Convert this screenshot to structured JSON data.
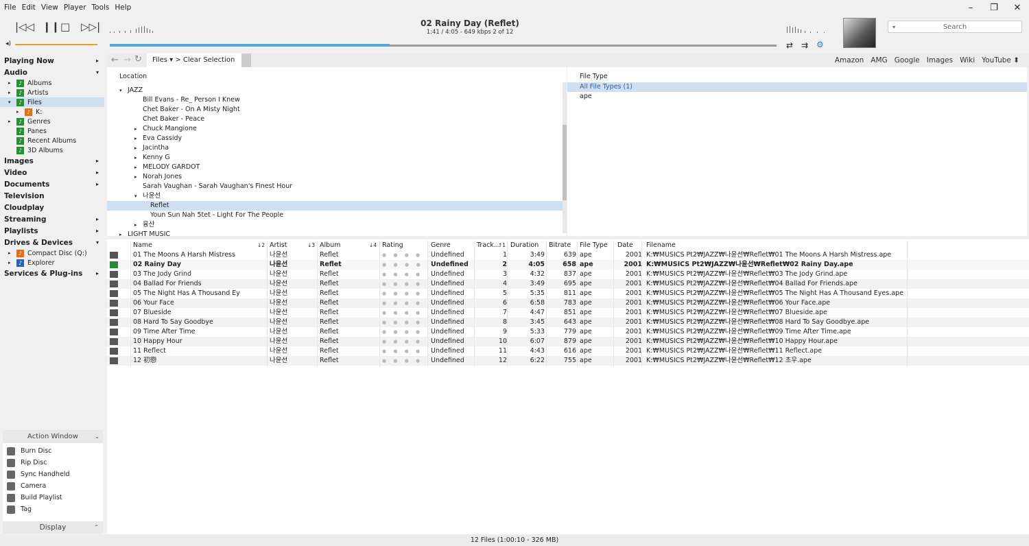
{
  "menu": [
    "File",
    "Edit",
    "View",
    "Player",
    "Tools",
    "Help"
  ],
  "window_controls": [
    "–",
    "❐",
    "✕"
  ],
  "transport": {
    "prev": "|◁◁",
    "pause": "❙❙",
    "stop": "□",
    "next": "▷▷|"
  },
  "now_playing": {
    "title": "02 Rainy Day (Reflet)",
    "info": "1:41 / 4:05 -  649 kbps   2 of 12",
    "progress": 0.42
  },
  "search": {
    "placeholder": "Search"
  },
  "sidebar": {
    "sections": [
      {
        "label": "Playing Now",
        "arrow": "▸"
      },
      {
        "label": "Audio",
        "arrow": "▾"
      }
    ],
    "audio_items": [
      "Albums",
      "Artists",
      "Files",
      "K:",
      "Genres",
      "Panes",
      "Recent Albums",
      "3D Albums"
    ],
    "sections2": [
      {
        "label": "Images",
        "arrow": "▸"
      },
      {
        "label": "Video",
        "arrow": "▸"
      },
      {
        "label": "Documents",
        "arrow": "▸"
      },
      {
        "label": "Television",
        "arrow": ""
      },
      {
        "label": "Cloudplay",
        "arrow": ""
      },
      {
        "label": "Streaming",
        "arrow": "▸"
      },
      {
        "label": "Playlists",
        "arrow": "▸"
      },
      {
        "label": "Drives & Devices",
        "arrow": "▾"
      }
    ],
    "drive_items": [
      "Compact Disc (Q:)",
      "Explorer"
    ],
    "last_section": {
      "label": "Services & Plug-ins",
      "arrow": "▸"
    }
  },
  "action_window": {
    "title": "Action Window",
    "items": [
      "Burn Disc",
      "Rip Disc",
      "Sync Handheld",
      "Camera",
      "Build Playlist",
      "Tag"
    ],
    "display_label": "Display"
  },
  "toolbar": {
    "files_tab": "Files ▾  >  Clear Selection",
    "links": [
      "Amazon",
      "AMG",
      "Google",
      "Images",
      "Wiki",
      "YouTube ⬍"
    ]
  },
  "location": {
    "header": "Location",
    "items": [
      {
        "label": "JAZZ",
        "indent": 1,
        "tri": "▾"
      },
      {
        "label": "Bill Evans - Re_ Person I Knew",
        "indent": 2,
        "tri": ""
      },
      {
        "label": "Chet Baker - On A Misty Night",
        "indent": 2,
        "tri": ""
      },
      {
        "label": "Chet Baker - Peace",
        "indent": 2,
        "tri": ""
      },
      {
        "label": "Chuck Mangione",
        "indent": 2,
        "tri": "▸"
      },
      {
        "label": "Eva Cassidy",
        "indent": 2,
        "tri": "▸"
      },
      {
        "label": "Jacintha",
        "indent": 2,
        "tri": "▸"
      },
      {
        "label": "Kenny G",
        "indent": 2,
        "tri": "▸"
      },
      {
        "label": "MELODY GARDOT",
        "indent": 2,
        "tri": "▸"
      },
      {
        "label": "Norah Jones",
        "indent": 2,
        "tri": "▸"
      },
      {
        "label": "Sarah Vaughan - Sarah Vaughan's Finest Hour",
        "indent": 2,
        "tri": ""
      },
      {
        "label": "나윤선",
        "indent": 2,
        "tri": "▾"
      },
      {
        "label": "Reflet",
        "indent": 3,
        "tri": "",
        "selected": true
      },
      {
        "label": "Youn Sun Nah 5tet - Light For The People",
        "indent": 3,
        "tri": ""
      },
      {
        "label": "융산",
        "indent": 2,
        "tri": "▸"
      },
      {
        "label": "LIGHT MUSIC",
        "indent": 1,
        "tri": "▸"
      }
    ]
  },
  "file_type": {
    "header": "File Type",
    "items": [
      "All File Types (1)",
      "ape"
    ]
  },
  "columns": [
    "Name",
    "↓2",
    "Artist",
    "↓3",
    "Album",
    "↓4",
    "Rating",
    "Genre",
    "Track...",
    "↑1",
    "Duration",
    "Bitrate",
    "File Type",
    "Date",
    "Filename"
  ],
  "tracks": [
    {
      "name": "01 The Moons A Harsh Mistress",
      "artist": "나윤선",
      "album": "Reflet",
      "rating": "● ● ● ● ●",
      "genre": "Undefined",
      "track": "1",
      "duration": "3:49",
      "bitrate": "639",
      "type": "ape",
      "date": "2001",
      "file": "K:₩MUSICS Pt2₩JAZZ₩나윤선₩Reflet₩01 The Moons A Harsh Mistress.ape"
    },
    {
      "name": "02 Rainy Day",
      "artist": "나윤선",
      "album": "Reflet",
      "rating": "● ● ● ● ●",
      "genre": "Undefined",
      "track": "2",
      "duration": "4:05",
      "bitrate": "658",
      "type": "ape",
      "date": "2001",
      "file": "K:₩MUSICS Pt2₩JAZZ₩나윤선₩Reflet₩02 Rainy Day.ape",
      "playing": true
    },
    {
      "name": "03 The Jody Grind",
      "artist": "나윤선",
      "album": "Reflet",
      "rating": "● ● ● ● ●",
      "genre": "Undefined",
      "track": "3",
      "duration": "4:32",
      "bitrate": "837",
      "type": "ape",
      "date": "2001",
      "file": "K:₩MUSICS Pt2₩JAZZ₩나윤선₩Reflet₩03 The Jody Grind.ape"
    },
    {
      "name": "04 Ballad For Friends",
      "artist": "나윤선",
      "album": "Reflet",
      "rating": "● ● ● ● ●",
      "genre": "Undefined",
      "track": "4",
      "duration": "3:49",
      "bitrate": "695",
      "type": "ape",
      "date": "2001",
      "file": "K:₩MUSICS Pt2₩JAZZ₩나윤선₩Reflet₩04 Ballad For Friends.ape"
    },
    {
      "name": "05 The Night Has A Thousand Ey",
      "artist": "나윤선",
      "album": "Reflet",
      "rating": "● ● ● ● ●",
      "genre": "Undefined",
      "track": "5",
      "duration": "5:35",
      "bitrate": "811",
      "type": "ape",
      "date": "2001",
      "file": "K:₩MUSICS Pt2₩JAZZ₩나윤선₩Reflet₩05 The Night Has A Thousand Eyes.ape"
    },
    {
      "name": "06 Your Face",
      "artist": "나윤선",
      "album": "Reflet",
      "rating": "● ● ● ● ●",
      "genre": "Undefined",
      "track": "6",
      "duration": "6:58",
      "bitrate": "783",
      "type": "ape",
      "date": "2001",
      "file": "K:₩MUSICS Pt2₩JAZZ₩나윤선₩Reflet₩06 Your Face.ape"
    },
    {
      "name": "07 Blueside",
      "artist": "나윤선",
      "album": "Reflet",
      "rating": "● ● ● ● ●",
      "genre": "Undefined",
      "track": "7",
      "duration": "4:47",
      "bitrate": "851",
      "type": "ape",
      "date": "2001",
      "file": "K:₩MUSICS Pt2₩JAZZ₩나윤선₩Reflet₩07 Blueside.ape"
    },
    {
      "name": "08 Hard To Say Goodbye",
      "artist": "나윤선",
      "album": "Reflet",
      "rating": "● ● ● ● ●",
      "genre": "Undefined",
      "track": "8",
      "duration": "3:45",
      "bitrate": "643",
      "type": "ape",
      "date": "2001",
      "file": "K:₩MUSICS Pt2₩JAZZ₩나윤선₩Reflet₩08 Hard To Say Goodbye.ape"
    },
    {
      "name": "09 Time After Time",
      "artist": "나윤선",
      "album": "Reflet",
      "rating": "● ● ● ● ●",
      "genre": "Undefined",
      "track": "9",
      "duration": "5:33",
      "bitrate": "779",
      "type": "ape",
      "date": "2001",
      "file": "K:₩MUSICS Pt2₩JAZZ₩나윤선₩Reflet₩09 Time After Time.ape"
    },
    {
      "name": "10 Happy Hour",
      "artist": "나윤선",
      "album": "Reflet",
      "rating": "● ● ● ● ●",
      "genre": "Undefined",
      "track": "10",
      "duration": "6:07",
      "bitrate": "879",
      "type": "ape",
      "date": "2001",
      "file": "K:₩MUSICS Pt2₩JAZZ₩나윤선₩Reflet₩10 Happy Hour.ape"
    },
    {
      "name": "11 Reflect",
      "artist": "나윤선",
      "album": "Reflet",
      "rating": "● ● ● ● ●",
      "genre": "Undefined",
      "track": "11",
      "duration": "4:43",
      "bitrate": "616",
      "type": "ape",
      "date": "2001",
      "file": "K:₩MUSICS Pt2₩JAZZ₩나윤선₩Reflet₩11 Reflect.ape"
    },
    {
      "name": "12 初戀",
      "artist": "나윤선",
      "album": "Reflet",
      "rating": "● ● ● ● ●",
      "genre": "Undefined",
      "track": "12",
      "duration": "6:22",
      "bitrate": "755",
      "type": "ape",
      "date": "2001",
      "file": "K:₩MUSICS Pt2₩JAZZ₩나윤선₩Reflet₩12 초우.ape"
    }
  ],
  "status": "12 Files (1:00:10 - 326 MB)"
}
